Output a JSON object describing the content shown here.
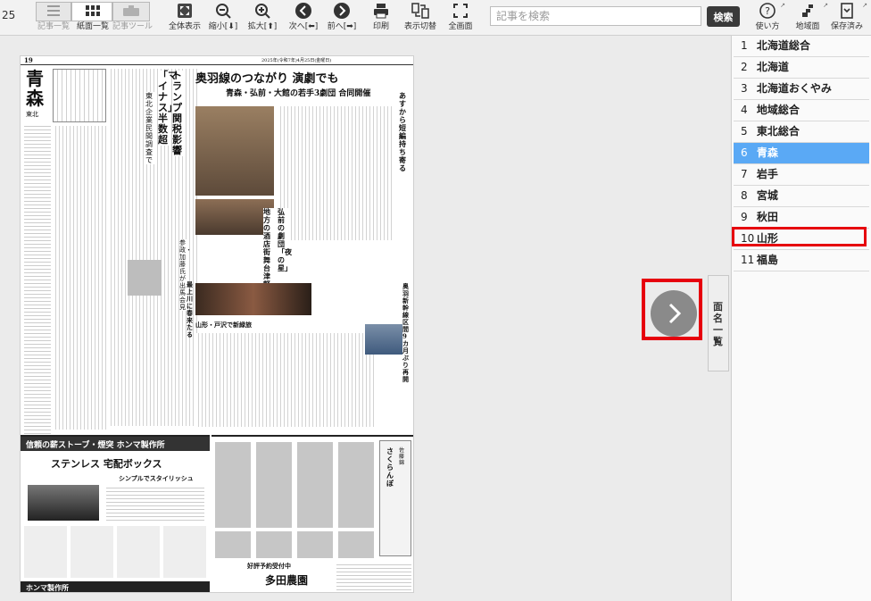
{
  "toolbar": {
    "page_indicator": "25",
    "buttons": {
      "article_list": "記事一覧",
      "page_list": "紙面一覧",
      "article_tool": "記事ツール",
      "fit": "全体表示",
      "zoom_out": "縮小[⬇]",
      "zoom_in": "拡大[⬆]",
      "next": "次へ[⬅]",
      "prev": "前へ[➡]",
      "print": "印刷",
      "display_switch": "表示切替",
      "fullscreen": "全画面",
      "howto": "使い方",
      "regional": "地域面",
      "saved": "保存済み"
    },
    "search_placeholder": "記事を検索",
    "search_button": "検索"
  },
  "viewer": {
    "side_tab_label": "面名一覧",
    "page": {
      "header_number": "19",
      "header_date": "2025年(令和7年)4月25日(金曜日)",
      "section": "青森",
      "area": "東北",
      "headline_main": "奥羽線のつながり 演劇でも",
      "headline_sub": "青森・弘前・大館の若手3劇団 合同開催",
      "headline_side": "あすから 短編持ち寄る",
      "headline_left_1": "トランプ関税影響",
      "headline_left_2": "「マイナス」半数超",
      "headline_left_3": "東北企業 民間調査で",
      "headline_mid_1": "弘前の劇団「夜の星」",
      "headline_mid_2": "地方の酒店街舞台 津軽弁で",
      "headline_mid_3": "参政・加藤氏が出馬会見",
      "headline_mid_4": "最上川に春来たる",
      "headline_mid_5": "山形・戸沢で新緑旅",
      "headline_right": "奥羽新幹線区間 9カ月ぶり再開",
      "ad_1_title": "信頼の薪ストーブ・煙突 ホンマ製作所",
      "ad_1_sub": "ステンレス 宅配ボックス",
      "ad_1_small": "シンプルでスタイリッシュ",
      "ad_1_footer": "ホンマ製作所",
      "ad_2_title": "さくらんぼ",
      "ad_2_sub": "佐藤錦",
      "ad_2_footer_1": "好評予約受付中",
      "ad_2_footer_2": "多田農園"
    }
  },
  "sidebar": {
    "items": [
      {
        "num": "1",
        "name": "北海道総合"
      },
      {
        "num": "2",
        "name": "北海道"
      },
      {
        "num": "3",
        "name": "北海道おくやみ"
      },
      {
        "num": "4",
        "name": "地域総合"
      },
      {
        "num": "5",
        "name": "東北総合"
      },
      {
        "num": "6",
        "name": "青森"
      },
      {
        "num": "7",
        "name": "岩手"
      },
      {
        "num": "8",
        "name": "宮城"
      },
      {
        "num": "9",
        "name": "秋田"
      },
      {
        "num": "10",
        "name": "山形"
      },
      {
        "num": "11",
        "name": "福島"
      }
    ],
    "selected_index": 5,
    "highlighted_index": 9
  },
  "colors": {
    "selected_bg": "#5aa9f5",
    "highlight_red": "#e6000e",
    "search_button_bg": "#3a3a3a"
  }
}
